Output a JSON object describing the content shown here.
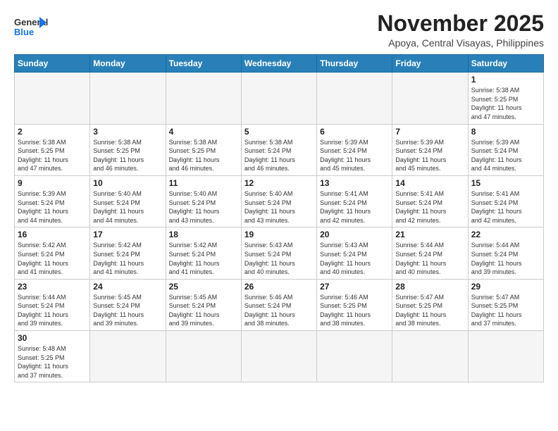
{
  "header": {
    "logo_general": "General",
    "logo_blue": "Blue",
    "month": "November 2025",
    "location": "Apoya, Central Visayas, Philippines"
  },
  "days_of_week": [
    "Sunday",
    "Monday",
    "Tuesday",
    "Wednesday",
    "Thursday",
    "Friday",
    "Saturday"
  ],
  "weeks": [
    [
      {
        "day": "",
        "info": ""
      },
      {
        "day": "",
        "info": ""
      },
      {
        "day": "",
        "info": ""
      },
      {
        "day": "",
        "info": ""
      },
      {
        "day": "",
        "info": ""
      },
      {
        "day": "",
        "info": ""
      },
      {
        "day": "1",
        "info": "Sunrise: 5:38 AM\nSunset: 5:25 PM\nDaylight: 11 hours\nand 47 minutes."
      }
    ],
    [
      {
        "day": "2",
        "info": "Sunrise: 5:38 AM\nSunset: 5:25 PM\nDaylight: 11 hours\nand 47 minutes."
      },
      {
        "day": "3",
        "info": "Sunrise: 5:38 AM\nSunset: 5:25 PM\nDaylight: 11 hours\nand 46 minutes."
      },
      {
        "day": "4",
        "info": "Sunrise: 5:38 AM\nSunset: 5:25 PM\nDaylight: 11 hours\nand 46 minutes."
      },
      {
        "day": "5",
        "info": "Sunrise: 5:38 AM\nSunset: 5:24 PM\nDaylight: 11 hours\nand 46 minutes."
      },
      {
        "day": "6",
        "info": "Sunrise: 5:39 AM\nSunset: 5:24 PM\nDaylight: 11 hours\nand 45 minutes."
      },
      {
        "day": "7",
        "info": "Sunrise: 5:39 AM\nSunset: 5:24 PM\nDaylight: 11 hours\nand 45 minutes."
      },
      {
        "day": "8",
        "info": "Sunrise: 5:39 AM\nSunset: 5:24 PM\nDaylight: 11 hours\nand 44 minutes."
      }
    ],
    [
      {
        "day": "9",
        "info": "Sunrise: 5:39 AM\nSunset: 5:24 PM\nDaylight: 11 hours\nand 44 minutes."
      },
      {
        "day": "10",
        "info": "Sunrise: 5:40 AM\nSunset: 5:24 PM\nDaylight: 11 hours\nand 44 minutes."
      },
      {
        "day": "11",
        "info": "Sunrise: 5:40 AM\nSunset: 5:24 PM\nDaylight: 11 hours\nand 43 minutes."
      },
      {
        "day": "12",
        "info": "Sunrise: 5:40 AM\nSunset: 5:24 PM\nDaylight: 11 hours\nand 43 minutes."
      },
      {
        "day": "13",
        "info": "Sunrise: 5:41 AM\nSunset: 5:24 PM\nDaylight: 11 hours\nand 42 minutes."
      },
      {
        "day": "14",
        "info": "Sunrise: 5:41 AM\nSunset: 5:24 PM\nDaylight: 11 hours\nand 42 minutes."
      },
      {
        "day": "15",
        "info": "Sunrise: 5:41 AM\nSunset: 5:24 PM\nDaylight: 11 hours\nand 42 minutes."
      }
    ],
    [
      {
        "day": "16",
        "info": "Sunrise: 5:42 AM\nSunset: 5:24 PM\nDaylight: 11 hours\nand 41 minutes."
      },
      {
        "day": "17",
        "info": "Sunrise: 5:42 AM\nSunset: 5:24 PM\nDaylight: 11 hours\nand 41 minutes."
      },
      {
        "day": "18",
        "info": "Sunrise: 5:42 AM\nSunset: 5:24 PM\nDaylight: 11 hours\nand 41 minutes."
      },
      {
        "day": "19",
        "info": "Sunrise: 5:43 AM\nSunset: 5:24 PM\nDaylight: 11 hours\nand 40 minutes."
      },
      {
        "day": "20",
        "info": "Sunrise: 5:43 AM\nSunset: 5:24 PM\nDaylight: 11 hours\nand 40 minutes."
      },
      {
        "day": "21",
        "info": "Sunrise: 5:44 AM\nSunset: 5:24 PM\nDaylight: 11 hours\nand 40 minutes."
      },
      {
        "day": "22",
        "info": "Sunrise: 5:44 AM\nSunset: 5:24 PM\nDaylight: 11 hours\nand 39 minutes."
      }
    ],
    [
      {
        "day": "23",
        "info": "Sunrise: 5:44 AM\nSunset: 5:24 PM\nDaylight: 11 hours\nand 39 minutes."
      },
      {
        "day": "24",
        "info": "Sunrise: 5:45 AM\nSunset: 5:24 PM\nDaylight: 11 hours\nand 39 minutes."
      },
      {
        "day": "25",
        "info": "Sunrise: 5:45 AM\nSunset: 5:24 PM\nDaylight: 11 hours\nand 39 minutes."
      },
      {
        "day": "26",
        "info": "Sunrise: 5:46 AM\nSunset: 5:24 PM\nDaylight: 11 hours\nand 38 minutes."
      },
      {
        "day": "27",
        "info": "Sunrise: 5:46 AM\nSunset: 5:25 PM\nDaylight: 11 hours\nand 38 minutes."
      },
      {
        "day": "28",
        "info": "Sunrise: 5:47 AM\nSunset: 5:25 PM\nDaylight: 11 hours\nand 38 minutes."
      },
      {
        "day": "29",
        "info": "Sunrise: 5:47 AM\nSunset: 5:25 PM\nDaylight: 11 hours\nand 37 minutes."
      }
    ],
    [
      {
        "day": "30",
        "info": "Sunrise: 5:48 AM\nSunset: 5:25 PM\nDaylight: 11 hours\nand 37 minutes."
      },
      {
        "day": "",
        "info": ""
      },
      {
        "day": "",
        "info": ""
      },
      {
        "day": "",
        "info": ""
      },
      {
        "day": "",
        "info": ""
      },
      {
        "day": "",
        "info": ""
      },
      {
        "day": "",
        "info": ""
      }
    ]
  ]
}
